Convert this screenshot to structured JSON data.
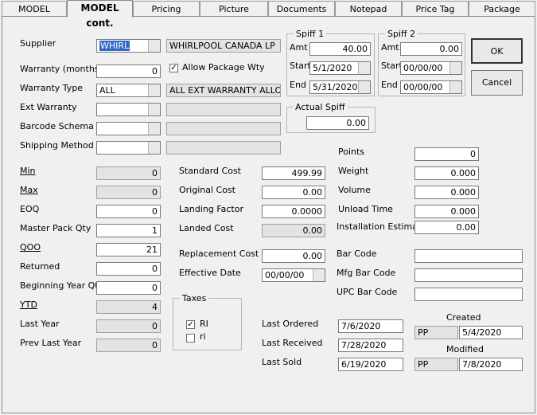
{
  "tabs": [
    "MODEL",
    "MODEL cont.",
    "Pricing",
    "Picture",
    "Documents",
    "Notepad",
    "Price Tag",
    "Package"
  ],
  "left": {
    "supplier_label": "Supplier",
    "supplier_code": "WHIRL",
    "supplier_name": "WHIRLPOOL CANADA LP",
    "warranty_months_label": "Warranty (months)",
    "warranty_months": "0",
    "allow_package_wty_label": "Allow Package Wty",
    "allow_package_wty": "✓",
    "warranty_type_label": "Warranty Type",
    "warranty_type": "ALL",
    "warranty_type_desc": "ALL EXT WARRANTY ALLO",
    "ext_warranty_label": "Ext Warranty",
    "barcode_schema_label": "Barcode Schema",
    "shipping_method_label": "Shipping Method"
  },
  "qty": {
    "min_label": "Min",
    "min": "0",
    "max_label": "Max",
    "max": "0",
    "eoq_label": "EOQ",
    "eoq": "0",
    "master_pack_label": "Master Pack Qty",
    "master_pack": "1",
    "qoo_label": "QOO",
    "qoo": "21",
    "returned_label": "Returned",
    "returned": "0",
    "beg_year_label": "Beginning Year Qty",
    "beg_year": "0",
    "ytd_label": "YTD",
    "ytd": "4",
    "last_year_label": "Last Year",
    "last_year": "0",
    "prev_last_year_label": "Prev Last Year",
    "prev_last_year": "0"
  },
  "cost": {
    "standard_label": "Standard Cost",
    "standard": "499.99",
    "original_label": "Original Cost",
    "original": "0.00",
    "landing_factor_label": "Landing Factor",
    "landing_factor": "0.0000",
    "landed_label": "Landed Cost",
    "landed": "0.00",
    "replacement_label": "Replacement Cost",
    "replacement": "0.00",
    "effective_label": "Effective Date",
    "effective": "00/00/00"
  },
  "taxes": {
    "title": "Taxes",
    "items": [
      {
        "label": "RI",
        "mark": "✓"
      },
      {
        "label": "ri",
        "mark": ""
      }
    ]
  },
  "spiff1": {
    "title": "Spiff 1",
    "amt_label": "Amt",
    "amt": "40.00",
    "start_label": "Start",
    "start": "5/1/2020",
    "end_label": "End",
    "end": "5/31/2020"
  },
  "spiff2": {
    "title": "Spiff 2",
    "amt_label": "Amt",
    "amt": "0.00",
    "start_label": "Start",
    "start": "00/00/00",
    "end_label": "End",
    "end": "00/00/00"
  },
  "actual_spiff": {
    "title": "Actual Spiff",
    "value": "0.00"
  },
  "buttons": {
    "ok": "OK",
    "cancel": "Cancel"
  },
  "physical": {
    "points_label": "Points",
    "points": "0",
    "weight_label": "Weight",
    "weight": "0.000",
    "volume_label": "Volume",
    "volume": "0.000",
    "unload_label": "Unload Time",
    "unload": "0.000",
    "install_label": "Installation Estimate",
    "install": "0.00"
  },
  "barcodes": {
    "bar_label": "Bar Code",
    "mfg_label": "Mfg Bar Code",
    "upc_label": "UPC Bar Code"
  },
  "history": {
    "last_ordered_label": "Last Ordered",
    "last_ordered": "7/6/2020",
    "last_received_label": "Last Received",
    "last_received": "7/28/2020",
    "last_sold_label": "Last Sold",
    "last_sold": "6/19/2020"
  },
  "audit": {
    "created_label": "Created",
    "created_by": "PP",
    "created_date": "5/4/2020",
    "modified_label": "Modified",
    "modified_by": "PP",
    "modified_date": "7/8/2020"
  }
}
